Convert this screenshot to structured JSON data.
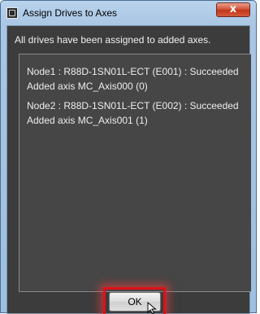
{
  "window": {
    "title": "Assign Drives to Axes",
    "close_glyph": "x"
  },
  "message": "All drives have been assigned to added axes.",
  "results": [
    {
      "line1": "Node1 : R88D-1SN01L-ECT (E001) : Succeeded",
      "line2": "Added axis MC_Axis000 (0)"
    },
    {
      "line1": "Node2 : R88D-1SN01L-ECT (E002) : Succeeded",
      "line2": "Added axis MC_Axis001 (1)"
    }
  ],
  "buttons": {
    "ok_label": "OK"
  },
  "icons": {
    "app": "app-icon",
    "close": "close-icon",
    "cursor": "mouse-pointer-icon"
  },
  "colors": {
    "highlight": "#e0101a",
    "close_button": "#c3351a",
    "dialog_background": "#3c3c3c"
  }
}
